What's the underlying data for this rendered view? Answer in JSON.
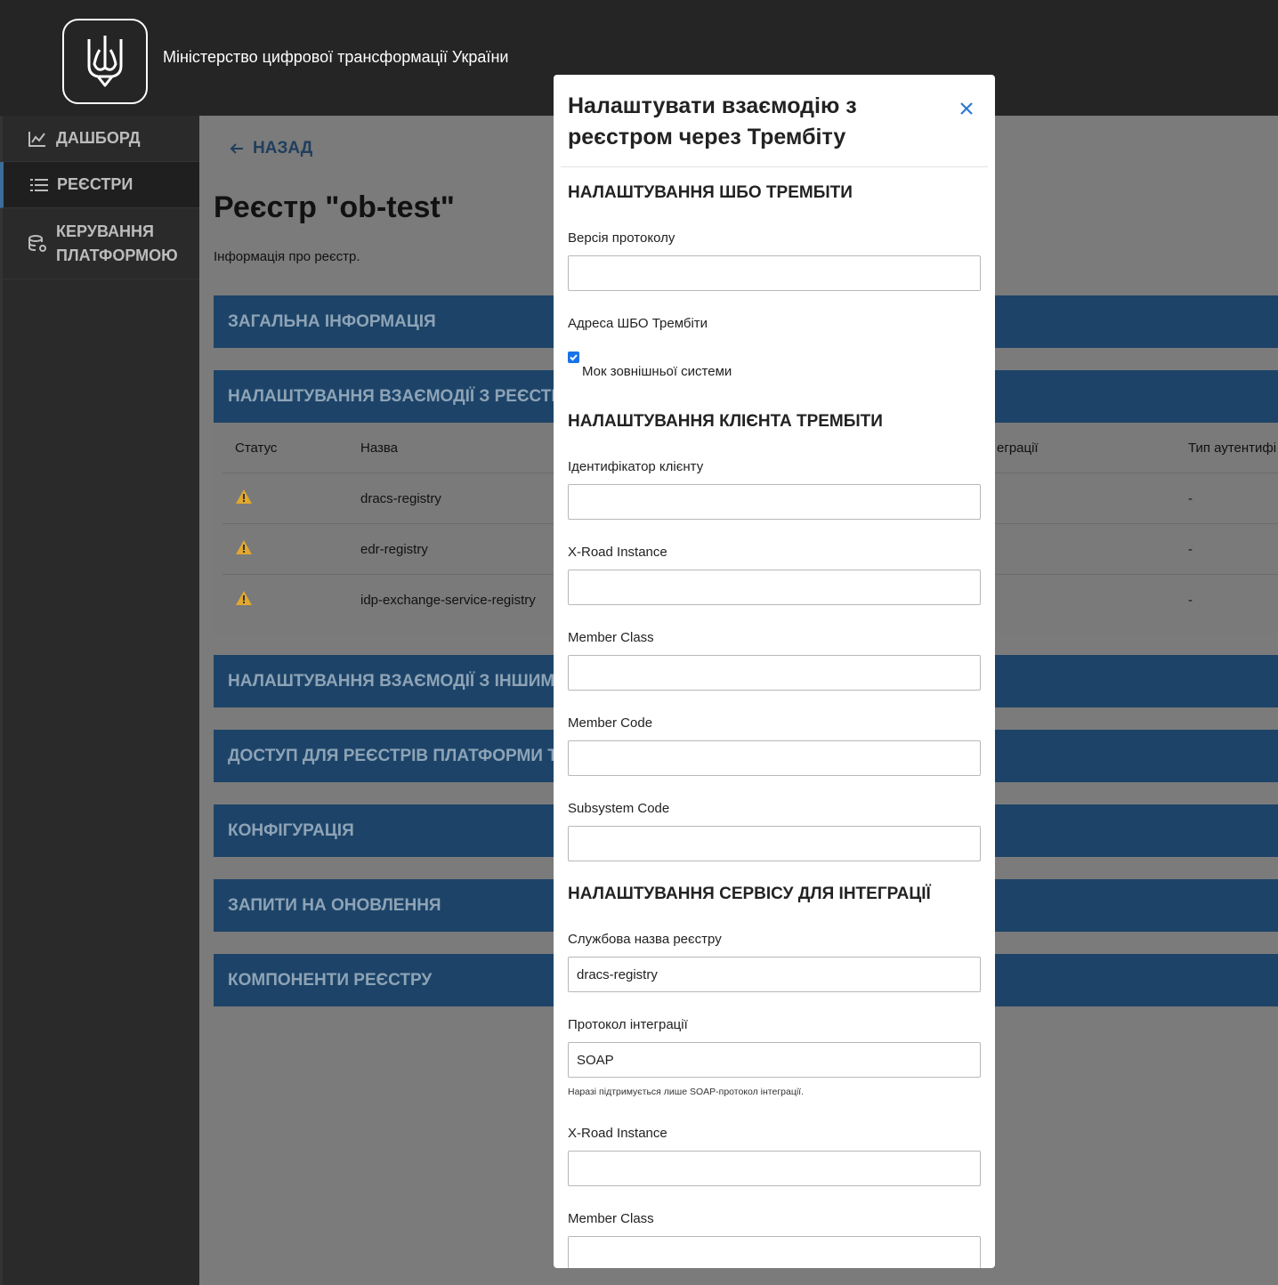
{
  "header": {
    "ministry": "Міністерство цифрової трансформації України",
    "logo_icon": "trident-icon"
  },
  "sidebar": {
    "items": [
      {
        "label": "Дашборд",
        "icon": "chart-icon"
      },
      {
        "label": "Реєстри",
        "icon": "list-icon"
      },
      {
        "label": "Керування",
        "label2": "платформою",
        "icon": "database-gear-icon"
      }
    ]
  },
  "main": {
    "back_label": "Назад",
    "title": "Реєстр \"ob-test\"",
    "subtitle": "Інформація про реєстр.",
    "accordions": [
      "Загальна інформація",
      "Налаштування взаємодії з реєстрами через Т",
      "Налаштування взаємодії з іншими системам",
      "Доступ для реєстрів платформи та зовнішні",
      "Конфігурація",
      "Запити на оновлення",
      "Компоненти реєстру"
    ],
    "table": {
      "headers": [
        "Статус",
        "Назва",
        "еграції",
        "Тип аутентифі"
      ],
      "rows": [
        {
          "name": "dracs-registry",
          "auth": "-"
        },
        {
          "name": "edr-registry",
          "auth": "-"
        },
        {
          "name": "idp-exchange-service-registry",
          "auth": "-"
        }
      ]
    }
  },
  "modal": {
    "title": "Налаштувати взаємодію з реєстром через Трембіту",
    "sections": {
      "trembita_shbo": "Налаштування ШБО Трембіти",
      "trembita_client": "Налаштування клієнта Трембіти",
      "service": "Налаштування сервісу для інтеграції"
    },
    "fields": {
      "protocol_version": {
        "label": "Версія протоколу",
        "value": ""
      },
      "shbo_address": {
        "label": "Адреса ШБО Трембіти"
      },
      "mock_checkbox": {
        "label": "Мок зовнішньої системи",
        "checked": true
      },
      "client_id": {
        "label": "Ідентифікатор клієнту",
        "value": ""
      },
      "xroad_instance": {
        "label": "X-Road Instance",
        "value": ""
      },
      "member_class": {
        "label": "Member Class",
        "value": ""
      },
      "member_code": {
        "label": "Member Code",
        "value": ""
      },
      "subsystem_code": {
        "label": "Subsystem Code",
        "value": ""
      },
      "registry_service_name": {
        "label": "Службова назва реєстру",
        "value": "dracs-registry"
      },
      "integration_protocol": {
        "label": "Протокол інтеграції",
        "value": "SOAP",
        "hint": "Наразі підтримується лише SOAP-протокол інтеграції."
      },
      "service_xroad_instance": {
        "label": "X-Road Instance",
        "value": ""
      },
      "service_member_class": {
        "label": "Member Class",
        "value": ""
      }
    }
  }
}
